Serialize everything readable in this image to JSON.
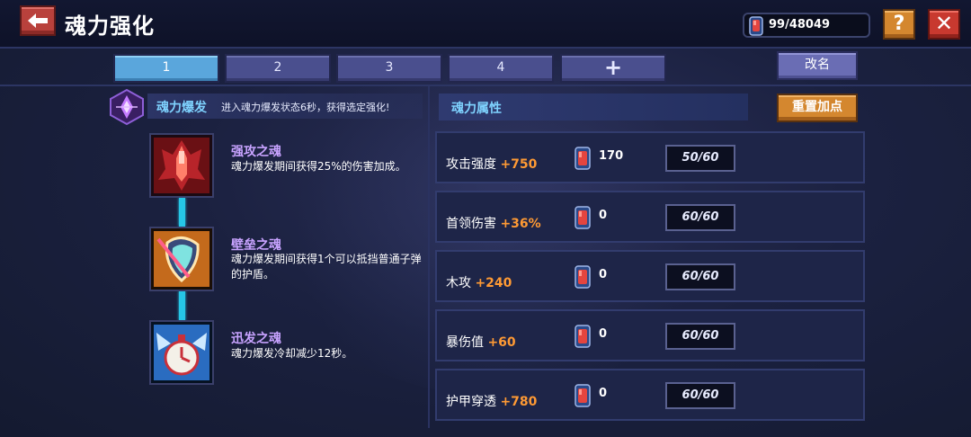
{
  "header": {
    "title": "魂力强化",
    "currency_value": "99/48049",
    "help_label": "?",
    "close_label": "✕"
  },
  "tabs": [
    {
      "label": "1",
      "active": true
    },
    {
      "label": "2",
      "active": false
    },
    {
      "label": "3",
      "active": false
    },
    {
      "label": "4",
      "active": false
    },
    {
      "label": "+",
      "active": false
    }
  ],
  "rename_label": "改名",
  "soul_burst": {
    "title": "魂力爆发",
    "description": "进入魂力爆发状态6秒，获得选定强化!"
  },
  "skills": [
    {
      "name": "强攻之魂",
      "description": "魂力爆发期间获得25%的伤害加成。",
      "icon": "red-ship-icon"
    },
    {
      "name": "壁垒之魂",
      "description": "魂力爆发期间获得1个可以抵挡普通子弹的护盾。",
      "icon": "shield-icon"
    },
    {
      "name": "迅发之魂",
      "description": "魂力爆发冷却减少12秒。",
      "icon": "stopwatch-icon"
    }
  ],
  "attributes_panel": {
    "title": "魂力属性",
    "reset_label": "重置加点"
  },
  "attributes": [
    {
      "name": "攻击强度",
      "bonus": "+750",
      "cost": "170",
      "level": "50/60"
    },
    {
      "name": "首领伤害",
      "bonus": "+36%",
      "cost": "0",
      "level": "60/60"
    },
    {
      "name": "木攻",
      "bonus": "+240",
      "cost": "0",
      "level": "60/60"
    },
    {
      "name": "暴伤值",
      "bonus": "+60",
      "cost": "0",
      "level": "60/60"
    },
    {
      "name": "护甲穿透",
      "bonus": "+780",
      "cost": "0",
      "level": "60/60"
    }
  ],
  "colors": {
    "background": "#1b2140",
    "accent_blue": "#5aa6dc",
    "bonus_orange": "#ff9a34",
    "skill_purple": "#c8a3ff",
    "title_cyan": "#7fd3ff"
  }
}
